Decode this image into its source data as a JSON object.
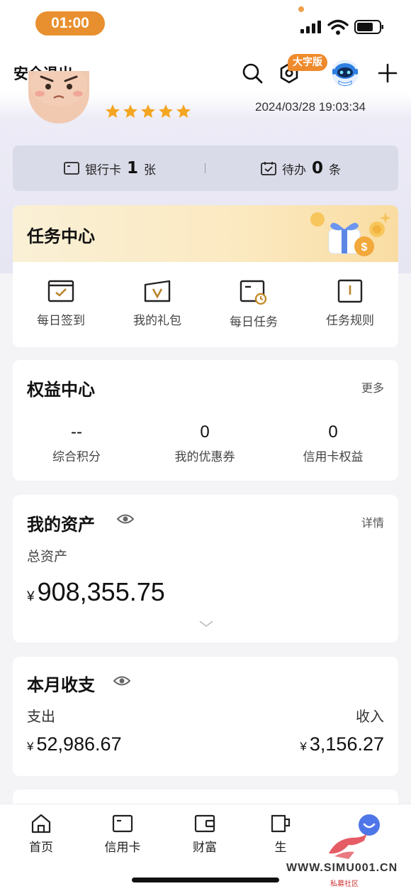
{
  "status_bar": {
    "time": "01:00"
  },
  "top_nav": {
    "logout_label": "安全退出",
    "large_font_badge": "大字版"
  },
  "profile": {
    "star_count": 5,
    "last_login": "2024/03/28 19:03:34"
  },
  "quick_bar": {
    "bank_card": {
      "label": "银行卡",
      "count": "1",
      "unit": "张"
    },
    "todo": {
      "label": "待办",
      "count": "0",
      "unit": "条"
    }
  },
  "task_center": {
    "title": "任务中心",
    "items": [
      {
        "label": "每日签到",
        "icon": "checkin-icon"
      },
      {
        "label": "我的礼包",
        "icon": "gift-icon"
      },
      {
        "label": "每日任务",
        "icon": "daily-task-icon"
      },
      {
        "label": "任务规则",
        "icon": "rules-book-icon"
      }
    ]
  },
  "rights_center": {
    "title": "权益中心",
    "more": "更多",
    "stats": [
      {
        "value": "--",
        "label": "综合积分"
      },
      {
        "value": "0",
        "label": "我的优惠券"
      },
      {
        "value": "0",
        "label": "信用卡权益"
      }
    ]
  },
  "assets": {
    "title": "我的资产",
    "detail": "详情",
    "total_label": "总资产",
    "currency": "¥",
    "total_value": "908,355.75"
  },
  "monthly": {
    "title": "本月收支",
    "expense_label": "支出",
    "income_label": "收入",
    "currency": "¥",
    "expense_value": "52,986.67",
    "income_value": "3,156.27"
  },
  "tab_bar": {
    "tabs": [
      {
        "label": "首页",
        "icon": "home-icon"
      },
      {
        "label": "信用卡",
        "icon": "credit-card-icon"
      },
      {
        "label": "财富",
        "icon": "wallet-icon"
      },
      {
        "label": "生",
        "icon": "cup-icon"
      },
      {
        "label": "",
        "icon": "assistant-icon"
      }
    ]
  },
  "watermark": {
    "text": "WWW.SIMU001.CN",
    "sub": "私募社区"
  },
  "colors": {
    "accent_orange": "#e8902f",
    "task_icon_brown": "#7a5a1e",
    "page_bg": "#f4f4f7"
  }
}
